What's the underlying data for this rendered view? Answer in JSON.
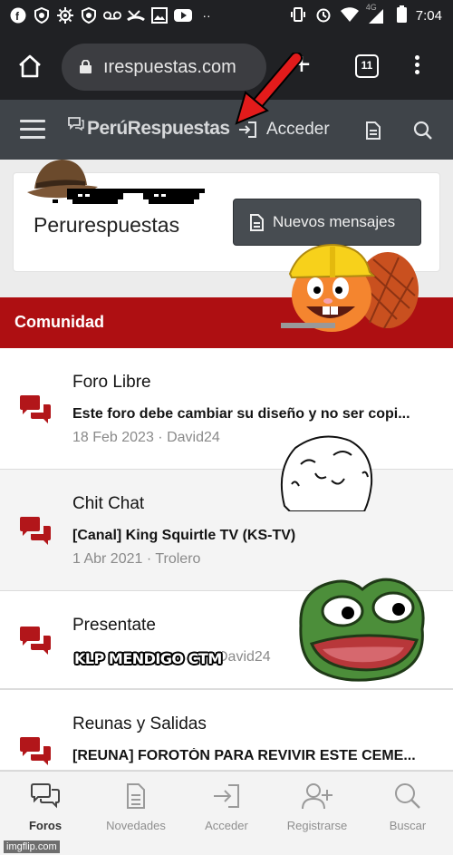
{
  "status_bar": {
    "network": "4G",
    "time": "7:04"
  },
  "browser": {
    "url": "ırespuestas.com",
    "tab_count": "11"
  },
  "site_header": {
    "logo": "PerúRespuestas",
    "login_label": "Acceder"
  },
  "top_card": {
    "title": "Perurespuestas",
    "new_messages_label": "Nuevos mensajes"
  },
  "section": {
    "title": "Comunidad"
  },
  "forums": [
    {
      "title": "Foro Libre",
      "last_thread": "Este foro debe cambiar su diseño y no ser copi...",
      "meta": "18 Feb 2023 · David24"
    },
    {
      "title": "Chit Chat",
      "last_thread": "[Canal] King Squirtle TV (KS-TV)",
      "meta": "1 Abr 2021 · Trolero"
    },
    {
      "title": "Presentate",
      "last_thread": "",
      "meta": "David24"
    },
    {
      "title": "Reunas y Salidas",
      "last_thread": "[REUNA] FOROTÓN PARA REVIVIR ESTE CEME..."
    }
  ],
  "overlay_text": "KLP MENDIGO CTM",
  "bottom_nav": [
    {
      "label": "Foros",
      "icon": "chat-bubbles-icon",
      "active": true
    },
    {
      "label": "Novedades",
      "icon": "document-icon",
      "active": false
    },
    {
      "label": "Acceder",
      "icon": "login-icon",
      "active": false
    },
    {
      "label": "Registrarse",
      "icon": "add-user-icon",
      "active": false
    },
    {
      "label": "Buscar",
      "icon": "search-icon",
      "active": false
    }
  ],
  "watermark": "imgflip.com",
  "colors": {
    "accent_red": "#ae0f12",
    "header_bg": "#3f4449",
    "browser_bg": "#202124"
  }
}
